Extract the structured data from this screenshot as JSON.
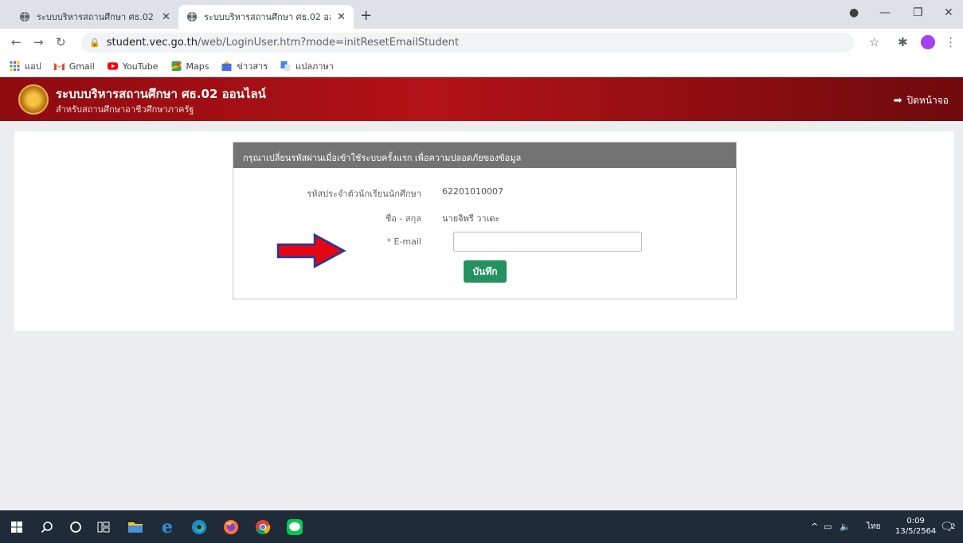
{
  "browser": {
    "tabs": [
      {
        "title": "ระบบบริหารสถานศึกษา ศธ.02 ออนไล",
        "active": false
      },
      {
        "title": "ระบบบริหารสถานศึกษา ศธ.02 ออนไล",
        "active": true
      }
    ],
    "new_tab": "+",
    "url_host": "student.vec.go.th",
    "url_path": "/web/LoginUser.htm?mode=initResetEmailStudent",
    "bookmarks": [
      {
        "label": "แอป",
        "icon": "apps-grid-icon"
      },
      {
        "label": "Gmail",
        "icon": "gmail-icon"
      },
      {
        "label": "YouTube",
        "icon": "youtube-icon"
      },
      {
        "label": "Maps",
        "icon": "maps-icon"
      },
      {
        "label": "ข่าวสาร",
        "icon": "news-icon"
      },
      {
        "label": "แปลภาษา",
        "icon": "translate-icon"
      }
    ]
  },
  "header": {
    "title": "ระบบบริหารสถานศึกษา ศธ.02 ออนไลน์",
    "subtitle": "สำหรับสถานศึกษาอาชีวศึกษาภาครัฐ",
    "logout_label": "ปิดหน้าจอ"
  },
  "form": {
    "heading": "กรุณาเปลี่ยนรหัสผ่านเมื่อเข้าใช้ระบบครั้งแรก เพื่อความปลอดภัยของข้อมูล",
    "student_id_label": "รหัสประจำตัวนักเรียนนักศึกษา",
    "student_id_value": "62201010007",
    "name_label": "ชื่อ - สกุล",
    "name_value": "นายจิพรี วาเดะ",
    "required_mark": "*",
    "email_label": "E-mail",
    "email_value": "",
    "save_label": "บันทึก"
  },
  "taskbar": {
    "lang": "ไทย",
    "time": "0:09",
    "date": "13/5/2564",
    "notifications": "2"
  },
  "colors": {
    "header_red": "#b21217",
    "save_green": "#239160",
    "card_head_gray": "#737373",
    "arrow_red": "#e30613",
    "arrow_outline": "#1f3b9b"
  }
}
